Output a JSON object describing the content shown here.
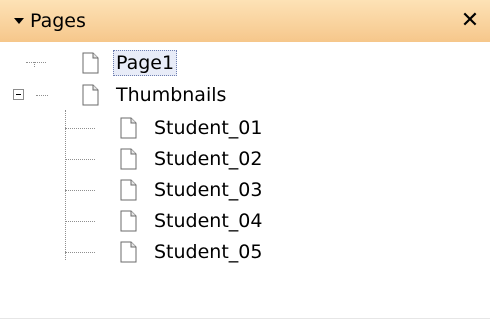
{
  "panel": {
    "title": "Pages",
    "close_glyph": "✕",
    "collapse_icon": "triangle-down-icon"
  },
  "tree": {
    "items": [
      {
        "label": "Page1",
        "selected": true,
        "level": 0
      },
      {
        "label": "Thumbnails",
        "selected": false,
        "level": 0,
        "expanded": true,
        "children": [
          {
            "label": "Student_01"
          },
          {
            "label": "Student_02"
          },
          {
            "label": "Student_03"
          },
          {
            "label": "Student_04"
          },
          {
            "label": "Student_05"
          }
        ]
      }
    ]
  },
  "colors": {
    "titlebar_top": "#fde2b6",
    "titlebar_bottom": "#f6c78b",
    "selection_bg": "#e8ecf8"
  }
}
